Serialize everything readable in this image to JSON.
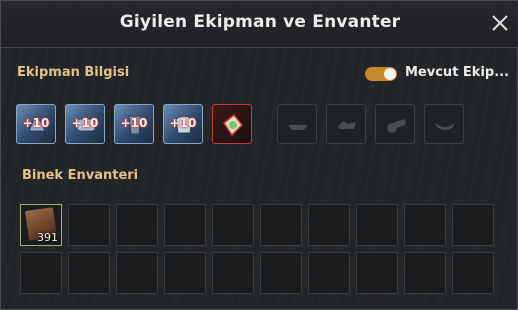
{
  "window": {
    "title": "Giyilen Ekipman ve Envanter",
    "close_icon": "close-icon"
  },
  "equipment": {
    "section_label": "Ekipman Bilgisi",
    "toggle_label": "Mevcut Ekip...",
    "toggle_on": true,
    "accent_color": "#c48a2a",
    "slots": [
      {
        "icon": "mount-armor-head-icon",
        "enhancement": "+10"
      },
      {
        "icon": "mount-armor-body-icon",
        "enhancement": "+10"
      },
      {
        "icon": "mount-armor-mask-icon",
        "enhancement": "+10"
      },
      {
        "icon": "mount-armor-barding-icon",
        "enhancement": "+10"
      },
      {
        "icon": "gem-card-icon",
        "enhancement": ""
      },
      {
        "icon": "boat-slot-icon",
        "enhancement": ""
      },
      {
        "icon": "cargo-slot-icon",
        "enhancement": ""
      },
      {
        "icon": "cannon-slot-icon",
        "enhancement": ""
      },
      {
        "icon": "ornament-slot-icon",
        "enhancement": ""
      }
    ]
  },
  "inventory": {
    "section_label": "Binek Envanteri",
    "items": [
      {
        "icon": "feed-book-icon",
        "count": "391"
      }
    ]
  }
}
